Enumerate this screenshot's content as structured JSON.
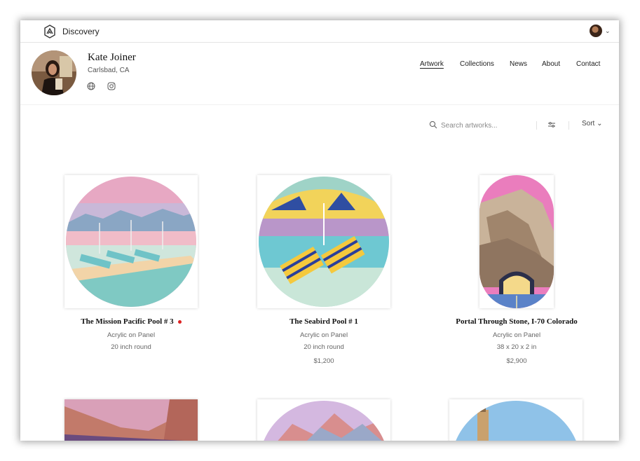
{
  "app": {
    "brand": "Discovery"
  },
  "profile": {
    "name": "Kate Joiner",
    "location": "Carlsbad, CA"
  },
  "nav": {
    "items": [
      "Artwork",
      "Collections",
      "News",
      "About",
      "Contact"
    ],
    "active": "Artwork"
  },
  "search": {
    "placeholder": "Search artworks..."
  },
  "sort": {
    "label": "Sort"
  },
  "artworks": [
    {
      "title": "The Mission Pacific Pool # 3",
      "medium": "Acrylic on Panel",
      "size": "20 inch round",
      "price": ""
    },
    {
      "title": "The Seabird Pool # 1",
      "medium": "Acrylic on Panel",
      "size": "20 inch round",
      "price": "$1,200"
    },
    {
      "title": "Portal Through Stone, I-70 Colorado",
      "medium": "Acrylic on Panel",
      "size": "38 x 20 x 2 in",
      "price": "$2,900"
    }
  ],
  "icons": [
    "discovery-logo-icon",
    "globe-icon",
    "instagram-icon",
    "search-icon",
    "filter-icon",
    "chevron-down-icon"
  ],
  "colors": {
    "accent_dot": "#dd2222",
    "border": "#e4e4e4",
    "muted_text": "#666666"
  }
}
